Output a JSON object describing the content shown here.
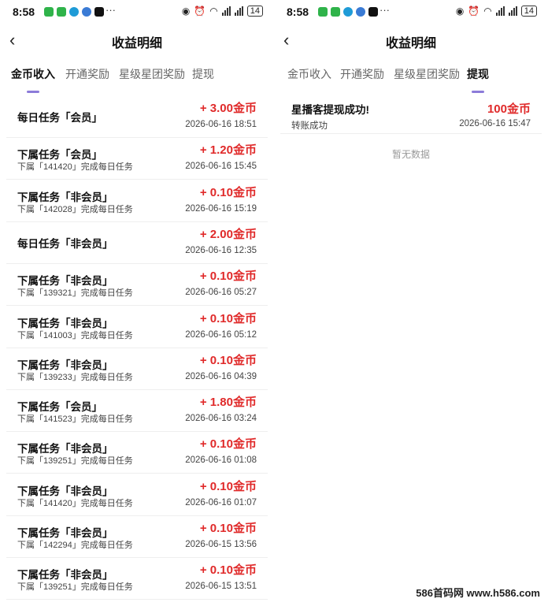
{
  "status": {
    "time": "8:58",
    "battery": "14",
    "dots": "···"
  },
  "app_title": "收益明细",
  "tabs": [
    "金币收入",
    "开通奖励",
    "星级星团奖励",
    "提现"
  ],
  "left": {
    "active_tab": 0,
    "records": [
      {
        "title": "每日任务「会员」",
        "sub": "",
        "amount": "+ 3.00金币",
        "date": "2026-06-16 18:51"
      },
      {
        "title": "下属任务「会员」",
        "sub": "下属「141420」完成每日任务",
        "amount": "+ 1.20金币",
        "date": "2026-06-16 15:45"
      },
      {
        "title": "下属任务「非会员」",
        "sub": "下属「142028」完成每日任务",
        "amount": "+ 0.10金币",
        "date": "2026-06-16 15:19"
      },
      {
        "title": "每日任务「非会员」",
        "sub": "",
        "amount": "+ 2.00金币",
        "date": "2026-06-16 12:35"
      },
      {
        "title": "下属任务「非会员」",
        "sub": "下属「139321」完成每日任务",
        "amount": "+ 0.10金币",
        "date": "2026-06-16 05:27"
      },
      {
        "title": "下属任务「非会员」",
        "sub": "下属「141003」完成每日任务",
        "amount": "+ 0.10金币",
        "date": "2026-06-16 05:12"
      },
      {
        "title": "下属任务「非会员」",
        "sub": "下属「139233」完成每日任务",
        "amount": "+ 0.10金币",
        "date": "2026-06-16 04:39"
      },
      {
        "title": "下属任务「会员」",
        "sub": "下属「141523」完成每日任务",
        "amount": "+ 1.80金币",
        "date": "2026-06-16 03:24"
      },
      {
        "title": "下属任务「非会员」",
        "sub": "下属「139251」完成每日任务",
        "amount": "+ 0.10金币",
        "date": "2026-06-16 01:08"
      },
      {
        "title": "下属任务「非会员」",
        "sub": "下属「141420」完成每日任务",
        "amount": "+ 0.10金币",
        "date": "2026-06-16 01:07"
      },
      {
        "title": "下属任务「非会员」",
        "sub": "下属「142294」完成每日任务",
        "amount": "+ 0.10金币",
        "date": "2026-06-15 13:56"
      },
      {
        "title": "下属任务「非会员」",
        "sub": "下属「139251」完成每日任务",
        "amount": "+ 0.10金币",
        "date": "2026-06-15 13:51"
      }
    ]
  },
  "right": {
    "active_tab": 3,
    "withdraw": {
      "title": "星播客提现成功!",
      "sub": "转账成功",
      "amount": "100金币",
      "date": "2026-06-16 15:47"
    },
    "empty_text": "暂无数据"
  },
  "watermark": "586首码网 www.h586.com",
  "colors": {
    "amount_red": "#e02a2a",
    "tab_indicator": "#8c7bd9"
  },
  "icons": [
    "back-arrow-icon",
    "eye-icon",
    "alarm-icon",
    "wifi-icon",
    "signal-icon",
    "battery-icon"
  ]
}
